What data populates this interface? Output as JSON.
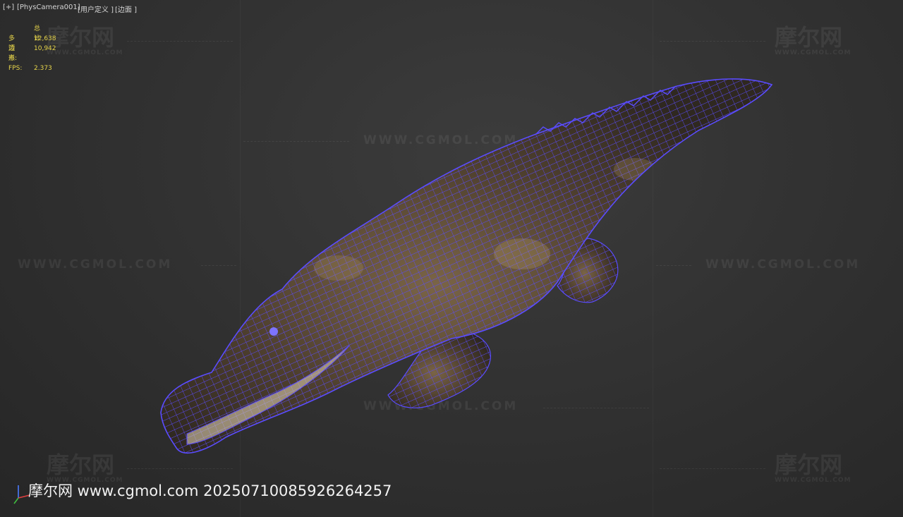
{
  "viewport": {
    "labels": {
      "plus": "[+]",
      "camera": "[PhysCamera001]",
      "view_mode": "[用户定义 ]",
      "shading": "[边面 ]"
    },
    "stats": {
      "header": "总计",
      "polygons_label": "多边形:",
      "polygons_value": "12,638",
      "vertices_label": "顶点:",
      "vertices_value": "10,942",
      "fps_label": "FPS:",
      "fps_value": "2.373"
    },
    "watermark": {
      "url": "WWW.CGMOL.COM",
      "logo": "摩尔网",
      "logo_sub": "WWW.CGMOL.COM"
    },
    "footer_watermark": "摩尔网 www.cgmol.com 20250710085926264257",
    "model": {
      "type": "crocodile",
      "display": "edged-faces wireframe",
      "wire_color": "#5a4cff",
      "skin_color": "#5a4a35"
    }
  }
}
